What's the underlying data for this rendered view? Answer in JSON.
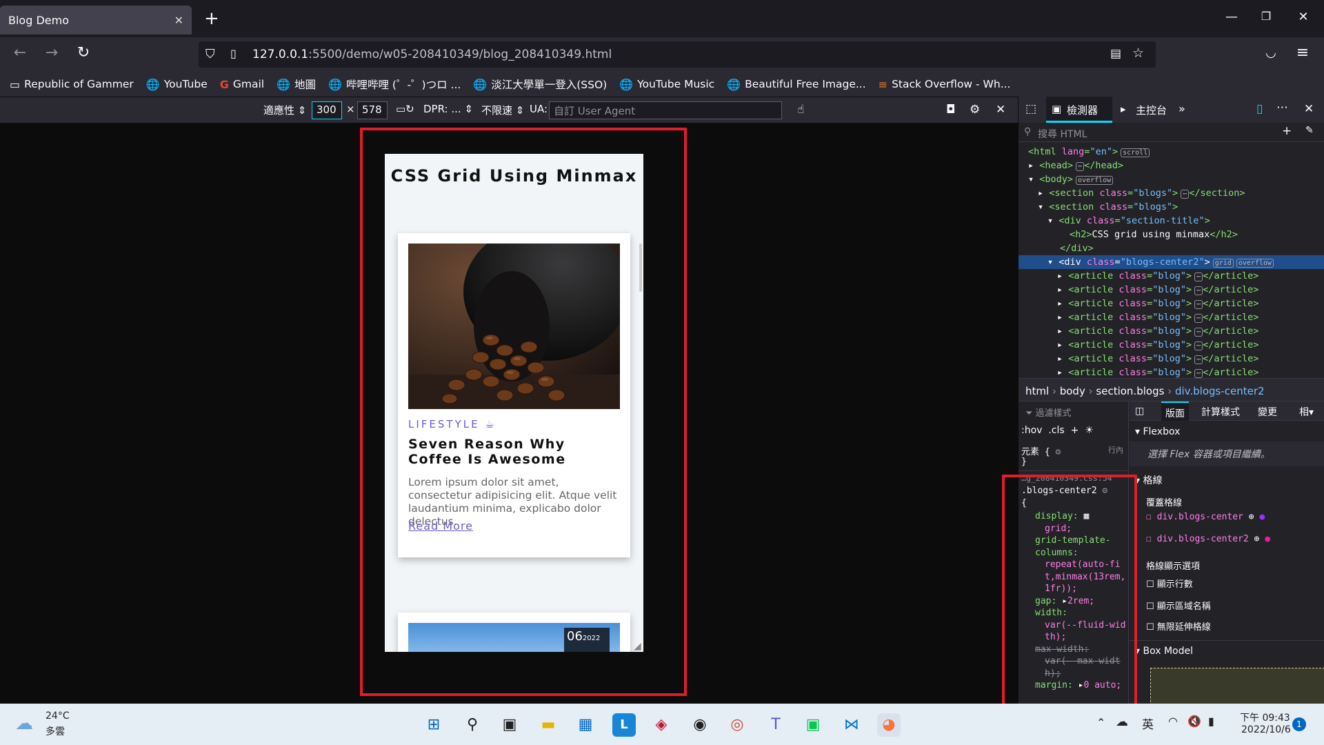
{
  "browser": {
    "tab_title": "Blog Demo",
    "url_host": "127.0.0.1",
    "url_path": ":5500/demo/w05-208410349/blog_208410349.html",
    "bookmarks": [
      "Republic of Gammer",
      "YouTube",
      "Gmail",
      "地圖",
      "哔哩哔哩 (゜-゜)つロ ...",
      "淡江大學單一登入(SSO)",
      "YouTube Music",
      "Beautiful Free Image...",
      "Stack Overflow - Wh..."
    ]
  },
  "rdm": {
    "responsive": "適應性",
    "width": "300",
    "times": "×",
    "height": "578",
    "dpr": "DPR: ...",
    "throttle": "不限速",
    "ua_label": "UA:",
    "ua_placeholder": "自訂 User Agent"
  },
  "page": {
    "heading": "CSS Grid Using Minmax",
    "card": {
      "category": "LIFESTYLE",
      "title": "Seven Reason Why Coffee Is Awesome",
      "text": "Lorem ipsum dolor sit amet, consectetur adipisicing elit. Atque velit laudantium minima, explicabo dolor delectus.",
      "link": "Read More"
    },
    "card2_date_day": "06",
    "card2_date_year": "2022"
  },
  "devtools": {
    "tab_inspector": "檢測器",
    "tab_console": "主控台",
    "search_placeholder": "搜尋 HTML",
    "tree": [
      "<html lang=\"en\">",
      "<head>…</head>",
      "<body>",
      "<section class=\"blogs\">…</section>",
      "<section class=\"blogs\">",
      "<div class=\"section-title\">",
      "<h2>CSS grid using minmax</h2>",
      "</div>",
      "<div class=\"blogs-center2\">",
      "<article class=\"blog\">…</article>"
    ],
    "badges": {
      "scroll": "scroll",
      "overflow": "overflow",
      "grid": "grid"
    },
    "breadcrumbs": [
      "html",
      "body",
      "section.blogs",
      "div.blogs-center2"
    ],
    "rules": {
      "filter": "過濾樣式",
      "hov": ":hov",
      "cls": ".cls",
      "element": "元素 {",
      "inline": "行內",
      "close_brace": "}",
      "source": "…g_208410349.css:54",
      "selector": ".blogs-center2",
      "open_brace": "{",
      "decls": [
        {
          "p": "display:",
          "v": "grid;"
        },
        {
          "p": "grid-template-columns:",
          "v": "repeat(auto-fit,minmax(13rem, 1fr));"
        },
        {
          "p": "gap:",
          "v": "2rem;"
        },
        {
          "p": "width:",
          "v": "var(--fluid-width);"
        },
        {
          "p": "max-width:",
          "v": "var(--max-width);"
        },
        {
          "p": "margin:",
          "v": "0 auto;"
        }
      ]
    },
    "layout": {
      "tabs": [
        "版面",
        "計算樣式",
        "變更",
        "相"
      ],
      "flexbox": "Flexbox",
      "flex_hint": "選擇 Flex 容器或項目繼續。",
      "grid": "格線",
      "overlay": "覆蓋格線",
      "grid_items": [
        "div.blogs-center",
        "div.blogs-center2"
      ],
      "display_options": "格線顯示選項",
      "options": [
        "顯示行數",
        "顯示區域名稱",
        "無限延伸格線"
      ],
      "box_model": "Box Model"
    }
  },
  "taskbar": {
    "temp": "24°C",
    "weather": "多雲",
    "lang": "英",
    "time": "下午 09:43",
    "date": "2022/10/6",
    "notif": "1"
  },
  "colors": {
    "accent": "#6a5acd",
    "highlight": "#e11d2a"
  }
}
